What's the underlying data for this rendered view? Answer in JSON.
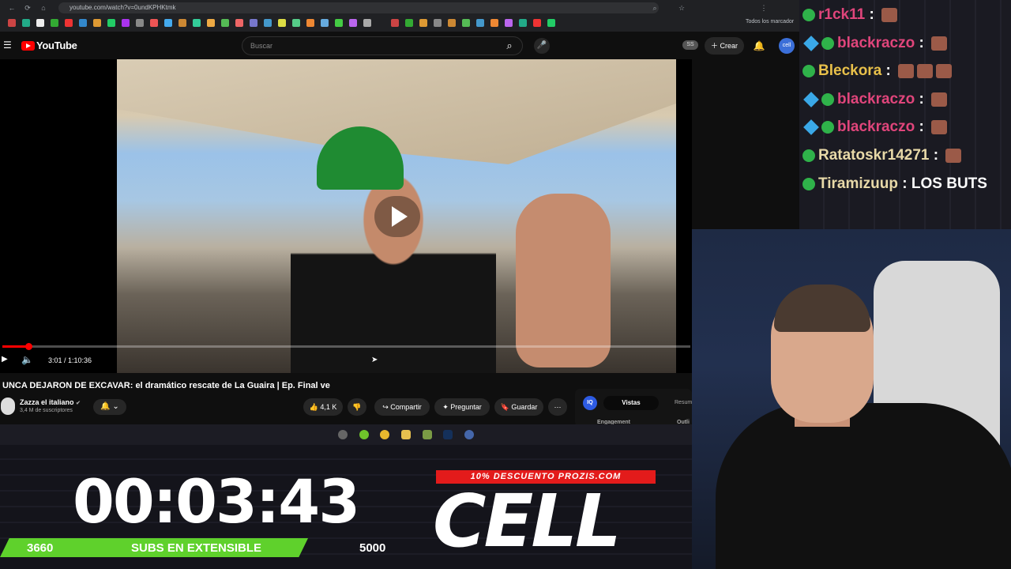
{
  "browser": {
    "url": "youtube.com/watch?v=0undKPHKtmk",
    "bookmarks_all": "Todos los marcador"
  },
  "youtube": {
    "logo": "YouTube",
    "search_placeholder": "Buscar",
    "ss_badge": "SS",
    "create_label": "Crear",
    "avatar": "cell"
  },
  "player": {
    "time": "3:01 / 1:10:36",
    "progress": 0.0427
  },
  "video": {
    "title": "UNCA DEJARON DE EXCAVAR: el dramático rescate de La Guaira | Ep. Final ve",
    "channel": "Zazza el italiano",
    "subscribers": "3,4 M de suscriptores",
    "likes": "4,1 K",
    "share": "Compartir",
    "ask": "Preguntar",
    "save": "Guardar"
  },
  "extension": {
    "iq": "IQ",
    "tab_active": "Vistas",
    "tab_other": "Resum",
    "engagement": "Engagement",
    "outli": "Outli"
  },
  "overlay": {
    "timer": "00:03:43",
    "subs_current": "3660",
    "subs_label": "SUBS EN EXTENSIBLE",
    "subs_goal": "5000",
    "promo": "10% DESCUENTO PROZIS.COM",
    "brand": "CELL"
  },
  "chat": [
    {
      "user": "r1ck11",
      "sep": ":",
      "badges": [
        "green"
      ],
      "message": "",
      "emotes": 1
    },
    {
      "user": "blackraczo",
      "sep": ":",
      "badges": [
        "cube",
        "green"
      ],
      "message": "",
      "emotes": 1
    },
    {
      "user": "Bleckora",
      "sep": ":",
      "badges": [
        "green"
      ],
      "message": "",
      "emotes": 3
    },
    {
      "user": "blackraczo",
      "sep": ":",
      "badges": [
        "cube",
        "green"
      ],
      "message": "",
      "emotes": 1
    },
    {
      "user": "blackraczo",
      "sep": ":",
      "badges": [
        "cube",
        "green"
      ],
      "message": "",
      "emotes": 1
    },
    {
      "user": "Ratatoskr14271",
      "sep": ":",
      "badges": [
        "green"
      ],
      "message": "",
      "emotes": 1
    },
    {
      "user": "Tiramizuup",
      "sep": ":",
      "badges": [
        "green"
      ],
      "message": "LOS BUTS",
      "emotes": 0
    }
  ],
  "chat_colors": [
    "#e0457b",
    "#e0457b",
    "#e8c04a",
    "#e0457b",
    "#e0457b",
    "#e8d9a8",
    "#e8d9a8"
  ]
}
